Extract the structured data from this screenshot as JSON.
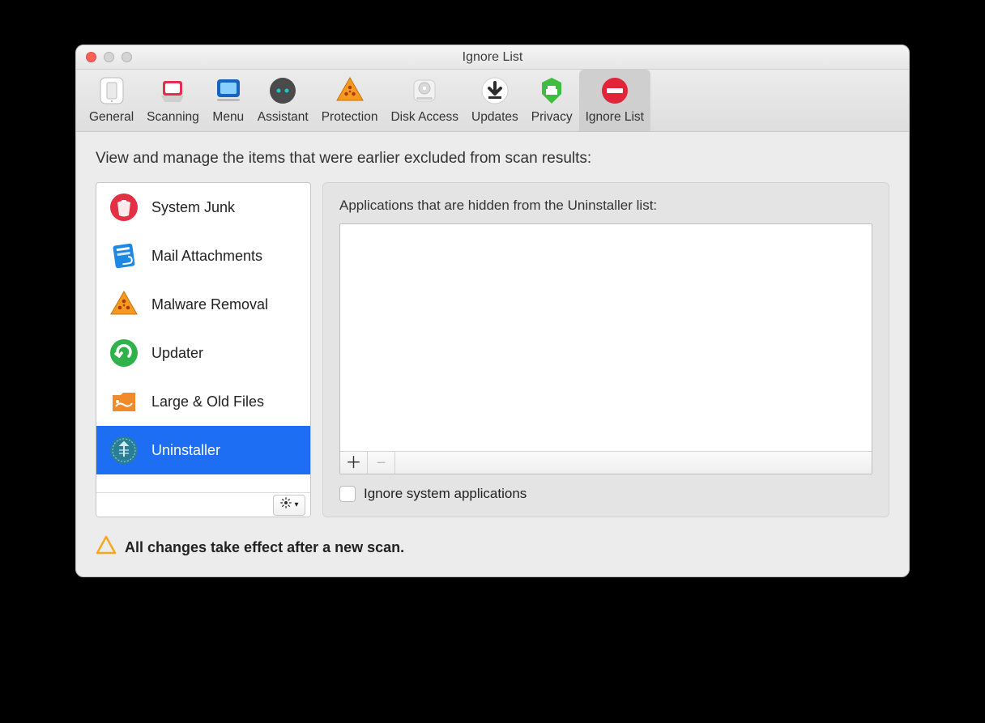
{
  "window": {
    "title": "Ignore List"
  },
  "toolbar": {
    "items": [
      {
        "label": "General"
      },
      {
        "label": "Scanning"
      },
      {
        "label": "Menu"
      },
      {
        "label": "Assistant"
      },
      {
        "label": "Protection"
      },
      {
        "label": "Disk Access"
      },
      {
        "label": "Updates"
      },
      {
        "label": "Privacy"
      },
      {
        "label": "Ignore List"
      }
    ],
    "active_index": 8
  },
  "body": {
    "instruction": "View and manage the items that were earlier excluded from scan results:"
  },
  "sidebar": {
    "items": [
      {
        "label": "System Junk"
      },
      {
        "label": "Mail Attachments"
      },
      {
        "label": "Malware Removal"
      },
      {
        "label": "Updater"
      },
      {
        "label": "Large & Old Files"
      },
      {
        "label": "Uninstaller"
      }
    ],
    "selected_index": 5
  },
  "rightpane": {
    "section_label": "Applications that are hidden from the Uninstaller list:",
    "add_symbol": "＋",
    "remove_symbol": "−",
    "checkbox_label": "Ignore system applications",
    "checkbox_checked": false
  },
  "footer_note": "All changes take effect after a new scan."
}
